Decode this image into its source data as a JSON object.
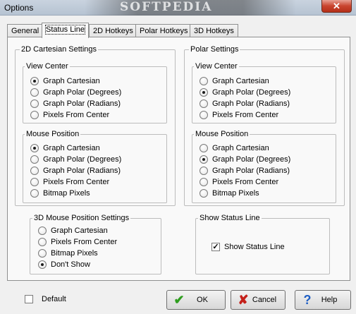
{
  "window": {
    "title": "Options",
    "watermark": "SOFTPEDIA",
    "close_glyph": "✕"
  },
  "tabs": [
    {
      "label": "General",
      "active": false
    },
    {
      "label": "Status Line",
      "active": true
    },
    {
      "label": "2D Hotkeys",
      "active": false
    },
    {
      "label": "Polar Hotkeys",
      "active": false
    },
    {
      "label": "3D Hotkeys",
      "active": false
    }
  ],
  "cartesian": {
    "title": "2D Cartesian Settings",
    "view_center": {
      "title": "View Center",
      "options": [
        "Graph Cartesian",
        "Graph Polar (Degrees)",
        "Graph Polar (Radians)",
        "Pixels From Center"
      ],
      "selected": 0
    },
    "mouse_position": {
      "title": "Mouse Position",
      "options": [
        "Graph Cartesian",
        "Graph Polar (Degrees)",
        "Graph Polar (Radians)",
        "Pixels From Center",
        "Bitmap Pixels"
      ],
      "selected": 0
    }
  },
  "polar": {
    "title": "Polar Settings",
    "view_center": {
      "title": "View Center",
      "options": [
        "Graph Cartesian",
        "Graph Polar (Degrees)",
        "Graph Polar (Radians)",
        "Pixels From Center"
      ],
      "selected": 1
    },
    "mouse_position": {
      "title": "Mouse Position",
      "options": [
        "Graph Cartesian",
        "Graph Polar (Degrees)",
        "Graph Polar (Radians)",
        "Pixels From Center",
        "Bitmap Pixels"
      ],
      "selected": 1
    }
  },
  "mouse3d": {
    "title": "3D Mouse Position Settings",
    "options": [
      "Graph Cartesian",
      "Pixels From Center",
      "Bitmap Pixels",
      "Don't Show"
    ],
    "selected": 3
  },
  "status_line": {
    "title": "Show Status Line",
    "checkbox_label": "Show Status Line",
    "checked": true,
    "check_glyph": "✓"
  },
  "footer": {
    "default_label": "Default",
    "default_checked": false,
    "ok_label": "OK",
    "cancel_label": "Cancel",
    "help_label": "Help",
    "ok_glyph": "✔",
    "cancel_glyph": "✘",
    "help_glyph": "?",
    "ok_color": "#2f9e1f",
    "cancel_color": "#c4201a",
    "help_color": "#1f5fc4"
  }
}
